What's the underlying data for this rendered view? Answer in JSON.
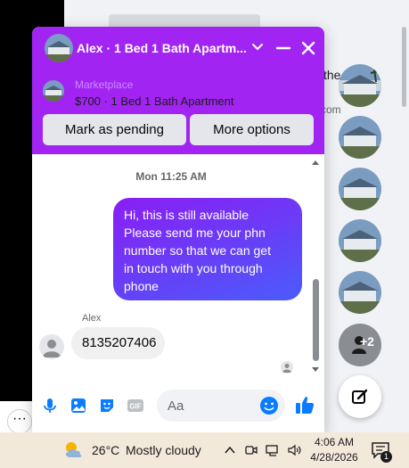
{
  "background": {
    "partial_text_1": "the",
    "partial_text_2": "e.com"
  },
  "chat": {
    "title": "Alex · 1 Bed 1 Bath Apartm...",
    "listing": {
      "source": "Marketplace",
      "title": "$700 · 1 Bed 1 Bath Apartment",
      "mark_pending_label": "Mark as pending",
      "more_options_label": "More options"
    },
    "messages": {
      "timestamp": "Mon 11:25 AM",
      "outgoing_lines": [
        "Hi, this is still available",
        "Please send me your phn",
        "number so that we can get",
        "in touch with you through",
        "phone"
      ],
      "sender_name": "Alex",
      "incoming_text": "8135207406"
    },
    "composer": {
      "placeholder": "Aa"
    }
  },
  "chat_heads": {
    "count_badge": "+2"
  },
  "colors": {
    "header": "#a224f3",
    "bubble_start": "#8a1ef5",
    "bubble_end": "#4a5cfb",
    "messenger_blue": "#0a7cff"
  },
  "taskbar": {
    "temperature": "26°C",
    "weather": "Mostly cloudy",
    "time": "4:06 AM",
    "date": "4/28/2026",
    "notification_count": "1"
  }
}
